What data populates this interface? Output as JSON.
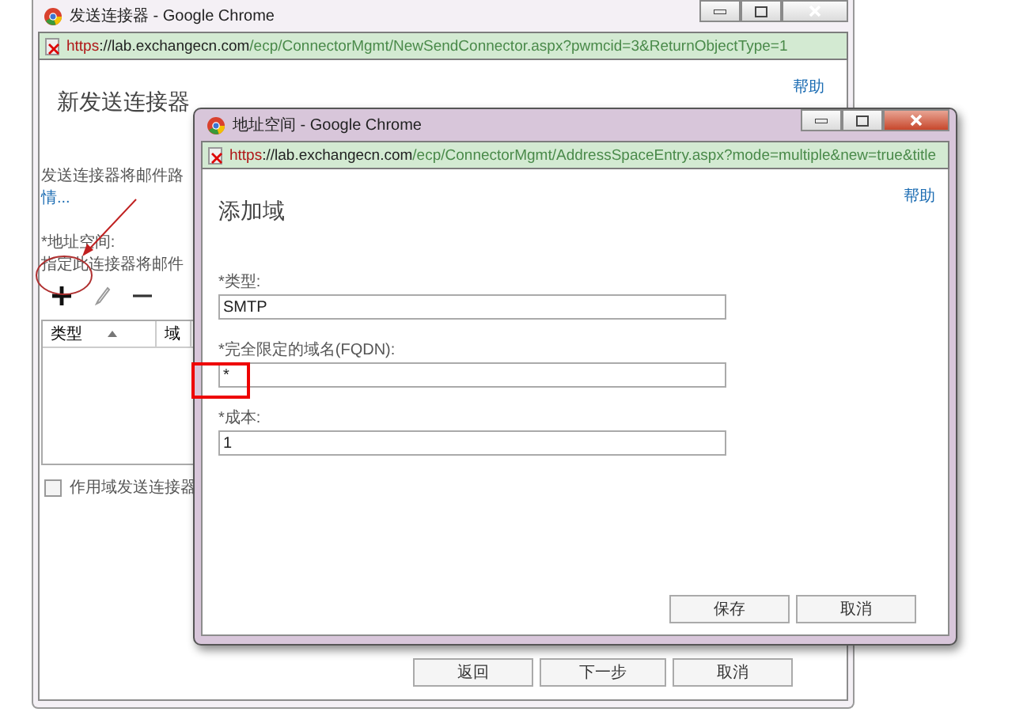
{
  "back_window": {
    "title": "发送连接器 - Google Chrome",
    "url": {
      "scheme": "https",
      "host": "://lab.exchangecn.com",
      "path": "/ecp/ConnectorMgmt/NewSendConnector.aspx?pwmcid=3&ReturnObjectType=1"
    },
    "help_link": "帮助",
    "heading": "新发送连接器",
    "description": "发送连接器将邮件路",
    "more_link": "情...",
    "address_space": {
      "label": "*地址空间:",
      "hint": "指定此连接器将邮件",
      "toolbar": [
        {
          "kind": "add"
        },
        {
          "kind": "edit"
        },
        {
          "kind": "remove"
        }
      ],
      "columns": [
        {
          "label": "类型",
          "sorted": true
        },
        {
          "label": "域",
          "sorted": false
        }
      ]
    },
    "scoped_checkbox": {
      "label": "作用域发送连接器",
      "checked": false
    },
    "buttons": [
      "返回",
      "下一步",
      "取消"
    ]
  },
  "dialog": {
    "title": "地址空间 - Google Chrome",
    "url": {
      "scheme": "https",
      "host": "://lab.exchangecn.com",
      "path": "/ecp/ConnectorMgmt/AddressSpaceEntry.aspx?mode=multiple&new=true&title"
    },
    "help_link": "帮助",
    "heading": "添加域",
    "fields": [
      {
        "label": "*类型:",
        "value": "SMTP"
      },
      {
        "label": "*完全限定的域名(FQDN):",
        "value": "*"
      },
      {
        "label": "*成本:",
        "value": "1"
      }
    ],
    "buttons": [
      "保存",
      "取消"
    ]
  }
}
